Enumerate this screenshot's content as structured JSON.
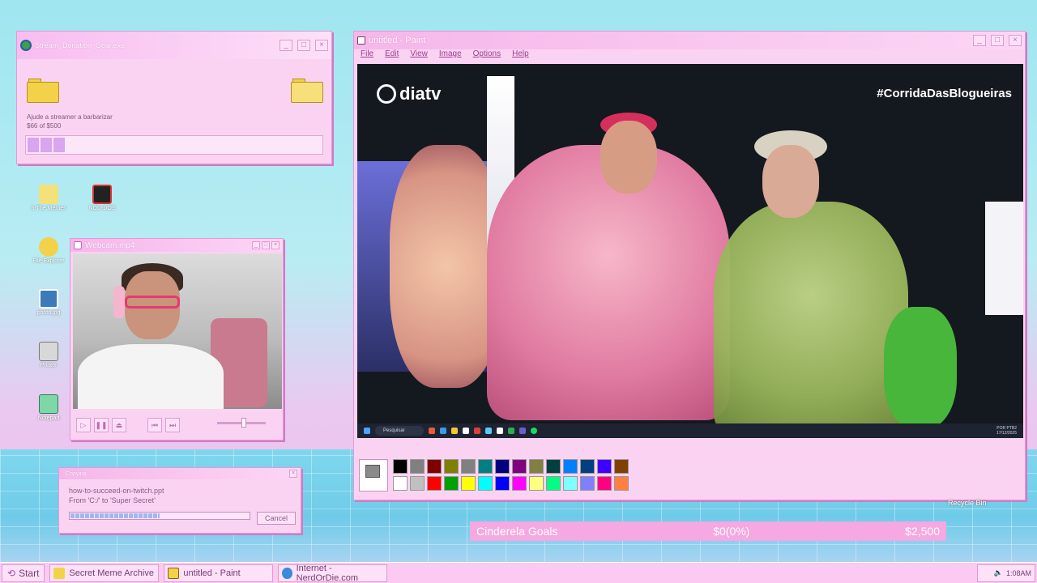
{
  "donation_window": {
    "title": "Stream_Donation_Goal.exe",
    "description": "Ajude a streamer a barbarizar",
    "amount": "$66 of $500",
    "progress": 0.132
  },
  "desktop_icons": [
    {
      "label": "5-The Memes",
      "icon": "envelope-icon"
    },
    {
      "label": "NOD-DOS",
      "icon": "nod-dos-icon"
    },
    {
      "label": "File Explorer",
      "icon": "magnifier-icon"
    },
    {
      "label": "photo.jpg",
      "icon": "picture-icon"
    },
    {
      "label": "Printer",
      "icon": "printer-icon"
    },
    {
      "label": "Notepad",
      "icon": "notepad-icon"
    }
  ],
  "webcam_window": {
    "title": "Webcam.mp4"
  },
  "paint_window": {
    "title": "untitled - Paint",
    "menu": [
      "File",
      "Edit",
      "View",
      "Image",
      "Options",
      "Help"
    ],
    "canvas": {
      "brand": "diatv",
      "hashtag": "#CorridaDasBlogueiras",
      "search_placeholder": "Pesquisar",
      "clock_line1": "POR PTB2",
      "clock_line2": "17/12/2025"
    },
    "palette": [
      "#000000",
      "#808080",
      "#800000",
      "#808000",
      "#808080",
      "#008080",
      "#000080",
      "#800080",
      "#808040",
      "#004040",
      "#0080ff",
      "#004080",
      "#4000ff",
      "#804000",
      "#ffffff",
      "#c0c0c0",
      "#ff0000",
      "#00a000",
      "#ffff00",
      "#00ffff",
      "#0000ff",
      "#ff00ff",
      "#ffff80",
      "#00ff80",
      "#80ffff",
      "#8080ff",
      "#ff0080",
      "#ff8040"
    ]
  },
  "copy_dialog": {
    "title": "Copying...",
    "file": "how-to-succeed-on-twitch.ppt",
    "path": "From 'C:/' to 'Super Secret'",
    "progress": 0.5,
    "cancel_label": "Cancel"
  },
  "goals_bar": {
    "name": "Cinderela Goals",
    "current": "$0(0%)",
    "target": "$2,500"
  },
  "recycle_label": "Recycle Bin",
  "taskbar": {
    "start_label": "Start",
    "items": [
      {
        "label": "Secret Meme Archive",
        "icon": "folder-icon"
      },
      {
        "label": "untitled - Paint",
        "icon": "paint-icon"
      },
      {
        "label": "Internet - NerdOrDie.com",
        "icon": "globe-icon"
      }
    ],
    "clock": "1:08AM"
  }
}
